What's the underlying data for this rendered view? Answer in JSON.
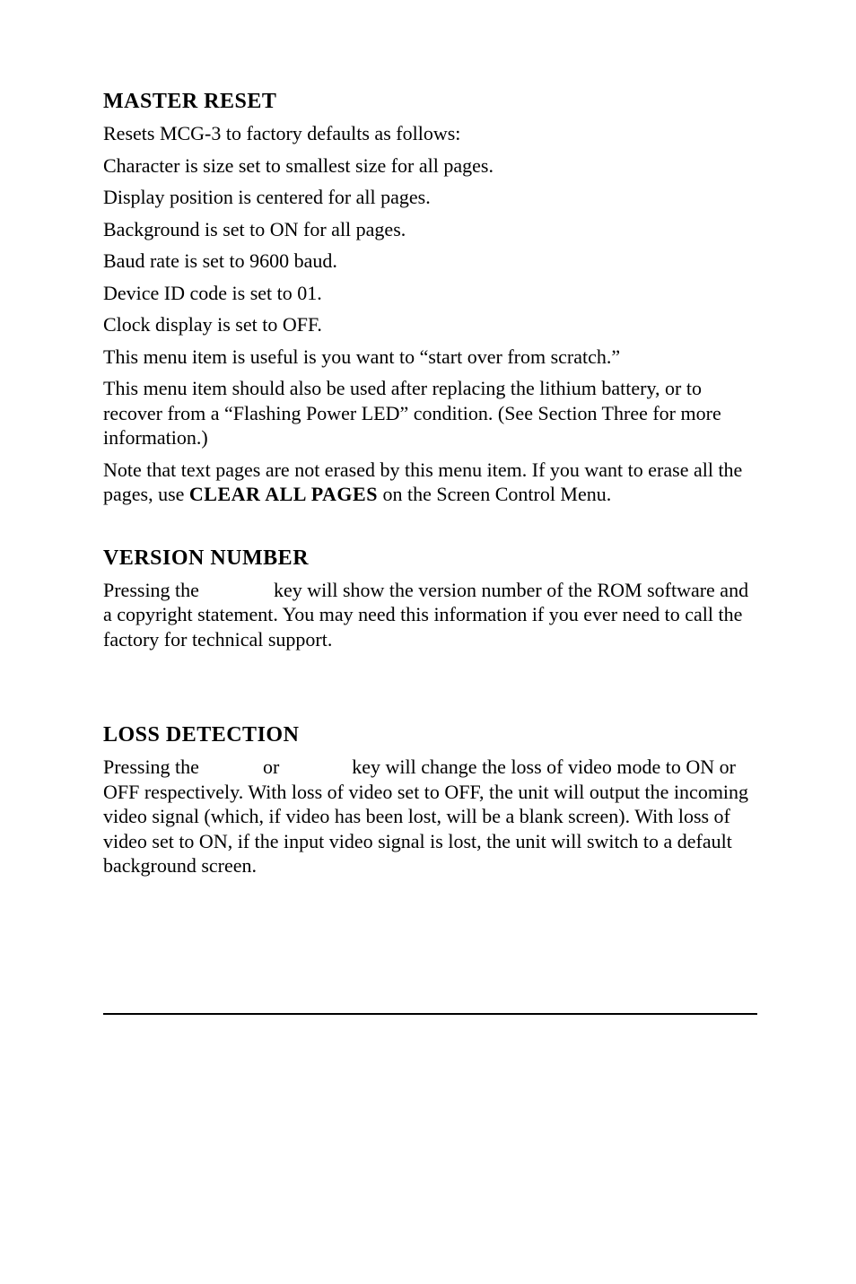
{
  "master_reset": {
    "heading": "MASTER RESET",
    "p1": "Resets MCG-3 to factory defaults as follows:",
    "p2": "Character is size set to smallest size for all pages.",
    "p3": "Display position is centered for all pages.",
    "p4": "Background is set to ON for all pages.",
    "p5": "Baud rate is set to 9600 baud.",
    "p6": "Device ID code is set to 01.",
    "p7": "Clock display is set to OFF.",
    "p8": "This menu item is useful is you want to “start over from scratch.”",
    "p9": "This menu item should also be used after replacing the lithium battery, or to recover from a “Flashing Power LED” condition. (See Section Three for more information.)",
    "p10a": "Note that text pages are not erased by this menu item. If you want to erase all the pages, use ",
    "p10_cmd": "CLEAR ALL PAGES",
    "p10b": " on the Screen Control Menu."
  },
  "version_number": {
    "heading": "VERSION NUMBER",
    "p1a": "Pressing the ",
    "p1b": " key will show the version number of the ROM software and a copyright statement. You may need this information if you ever need to call the factory for technical support."
  },
  "loss_detection": {
    "heading": "LOSS DETECTION",
    "p1a": "Pressing the ",
    "p1b": " or ",
    "p1c": " key will change the loss of video mode to ON or OFF respectively. With loss of video set to OFF, the unit will output the incoming video signal (which, if video has been lost, will be a blank screen). With loss of video set to ON, if the input video signal is lost, the unit will switch to a default background screen."
  }
}
